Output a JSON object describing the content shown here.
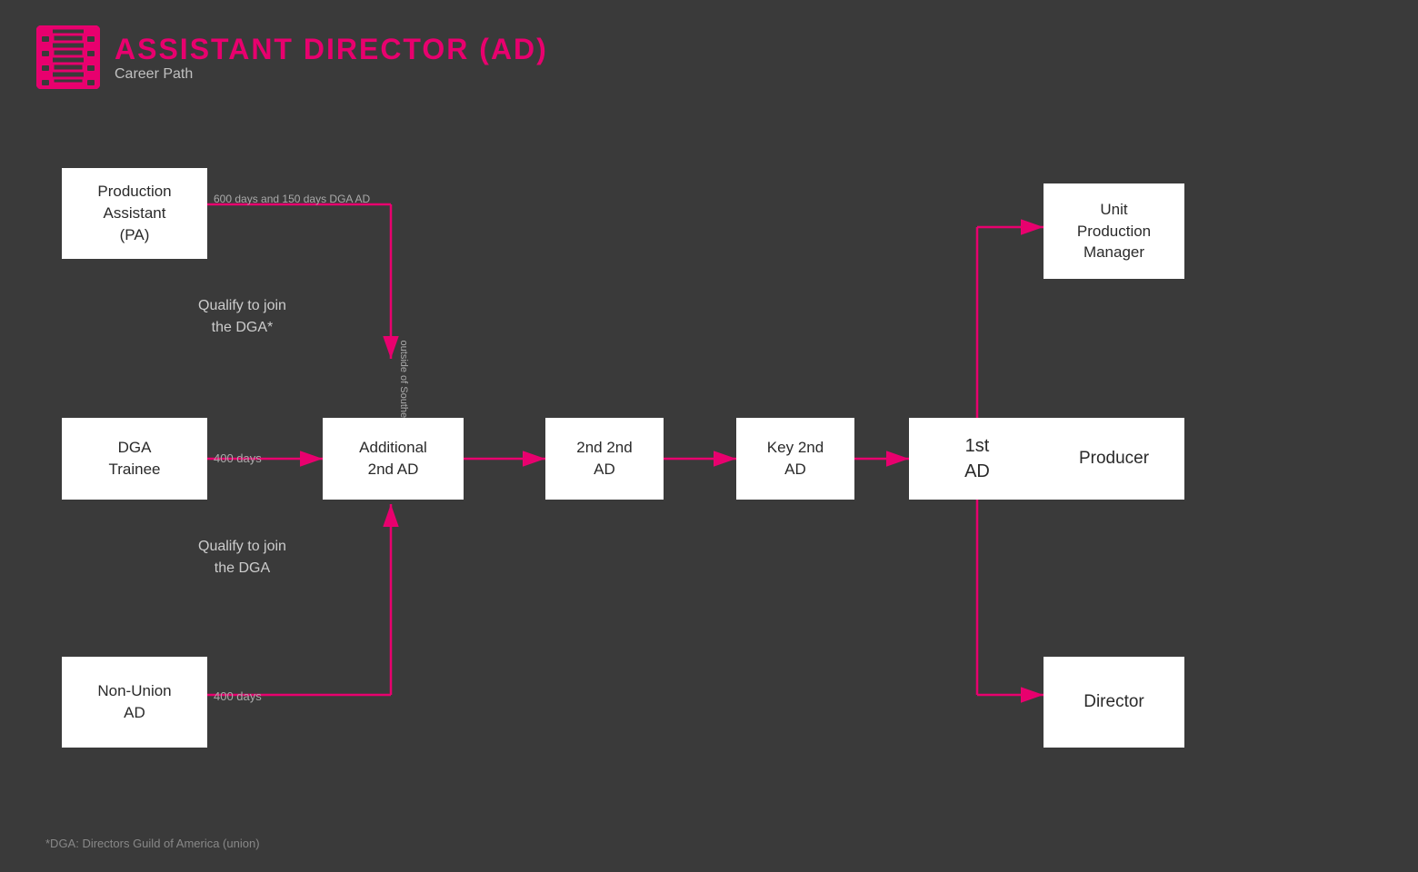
{
  "header": {
    "title": "ASSISTANT DIRECTOR (AD)",
    "subtitle": "Career Path"
  },
  "boxes": {
    "production_assistant": {
      "label": "Production\nAssistant\n(PA)"
    },
    "dga_trainee": {
      "label": "DGA\nTrainee"
    },
    "additional_2nd_ad": {
      "label": "Additional\n2nd AD"
    },
    "2nd_2nd_ad": {
      "label": "2nd 2nd\nAD"
    },
    "key_2nd_ad": {
      "label": "Key 2nd\nAD"
    },
    "1st_ad": {
      "label": "1st\nAD"
    },
    "unit_production_manager": {
      "label": "Unit\nProduction\nManager"
    },
    "producer": {
      "label": "Producer"
    },
    "non_union_ad": {
      "label": "Non-Union\nAD"
    },
    "director": {
      "label": "Director"
    }
  },
  "labels": {
    "qualify_top": "Qualify to join\nthe DGA*",
    "qualify_bottom": "Qualify to join\nthe DGA",
    "600_days": "600 days and 150 days DGA AD",
    "400_days_trainee": "400 days",
    "400_days_nonunion": "400 days",
    "outside_southern_ca": "outside of Southern California"
  },
  "footnote": "*DGA: Directors Guild of America (union)",
  "colors": {
    "pink": "#e8006e",
    "bg": "#3a3a3a",
    "box_bg": "#ffffff",
    "text_dark": "#2a2a2a",
    "text_light": "#b0b0b0"
  }
}
